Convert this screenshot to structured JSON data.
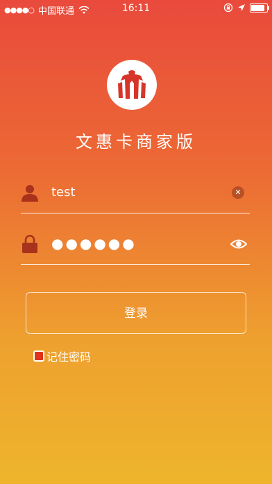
{
  "status_bar": {
    "signal_dots": "●●●●○",
    "carrier": "中国联通",
    "time": "16:11",
    "battery_level": 0.85
  },
  "app": {
    "title": "文惠卡商家版"
  },
  "form": {
    "username_value": "test",
    "password_value": "●●●●●●",
    "login_label": "登录",
    "remember_label": "记住密码",
    "remember_checked": true
  },
  "colors": {
    "gradient_top": "#e94a3c",
    "gradient_bottom": "#eeb52c",
    "logo_mark": "#d7352a"
  },
  "icons": {
    "user": "user-icon",
    "lock": "lock-icon",
    "clear": "clear-icon",
    "eye": "eye-icon",
    "wifi": "wifi-icon",
    "rotation_lock": "rotation-lock-icon",
    "location": "location-icon"
  }
}
